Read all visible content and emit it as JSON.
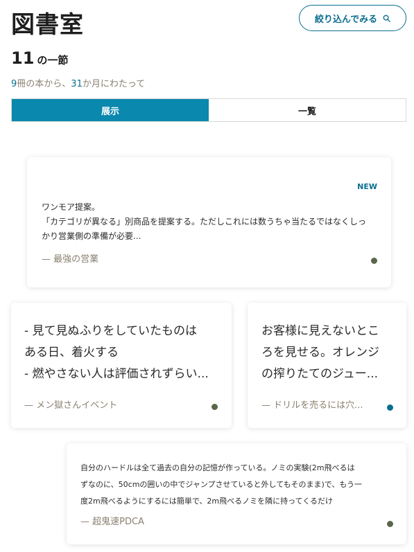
{
  "header": {
    "title": "図書室",
    "filter_label": "絞り込んでみる"
  },
  "stats": {
    "count": "11",
    "count_suffix": "の一節",
    "books": "9",
    "books_suffix": "冊の本から、",
    "months": "31",
    "months_suffix": "か月にわたって"
  },
  "tabs": [
    {
      "label": "展示",
      "active": true
    },
    {
      "label": "一覧",
      "active": false
    }
  ],
  "cards": [
    {
      "badge": "NEW",
      "lines": [
        "ワンモア提案。",
        "「カテゴリが異なる」別商品を提案する。ただしこれには数うちゃ当たるではなくしっ",
        "かり営業側の準備が必要..."
      ],
      "source": "— 最強の営業",
      "dot_color": "#5a6648"
    },
    {
      "lines": [
        "- 見て見ぬふりをしていたものは",
        "ある日、着火する",
        "- 燃やさない人は評価されずらい..."
      ],
      "source": "— メン獄さんイベント",
      "dot_color": "#5a6648"
    },
    {
      "lines": [
        "お客様に見えないとこ",
        "ろを見せる。オレンジ",
        "の搾りたてのジュー..."
      ],
      "source": "— ドリルを売るには穴...",
      "dot_color": "#0b6e8f"
    },
    {
      "lines": [
        "自分のハードルは全て過去の自分の記憶が作っている。ノミの実験(2m飛べるは",
        "ずなのに、50cmの囲いの中でジャンプさせていると外してもそのまま)で、もう一",
        "度2m飛べるようにするには簡単で、2m飛べるノミを隣に持ってくるだけ"
      ],
      "source": "— 超鬼速PDCA",
      "dot_color": "#5a6648"
    }
  ]
}
